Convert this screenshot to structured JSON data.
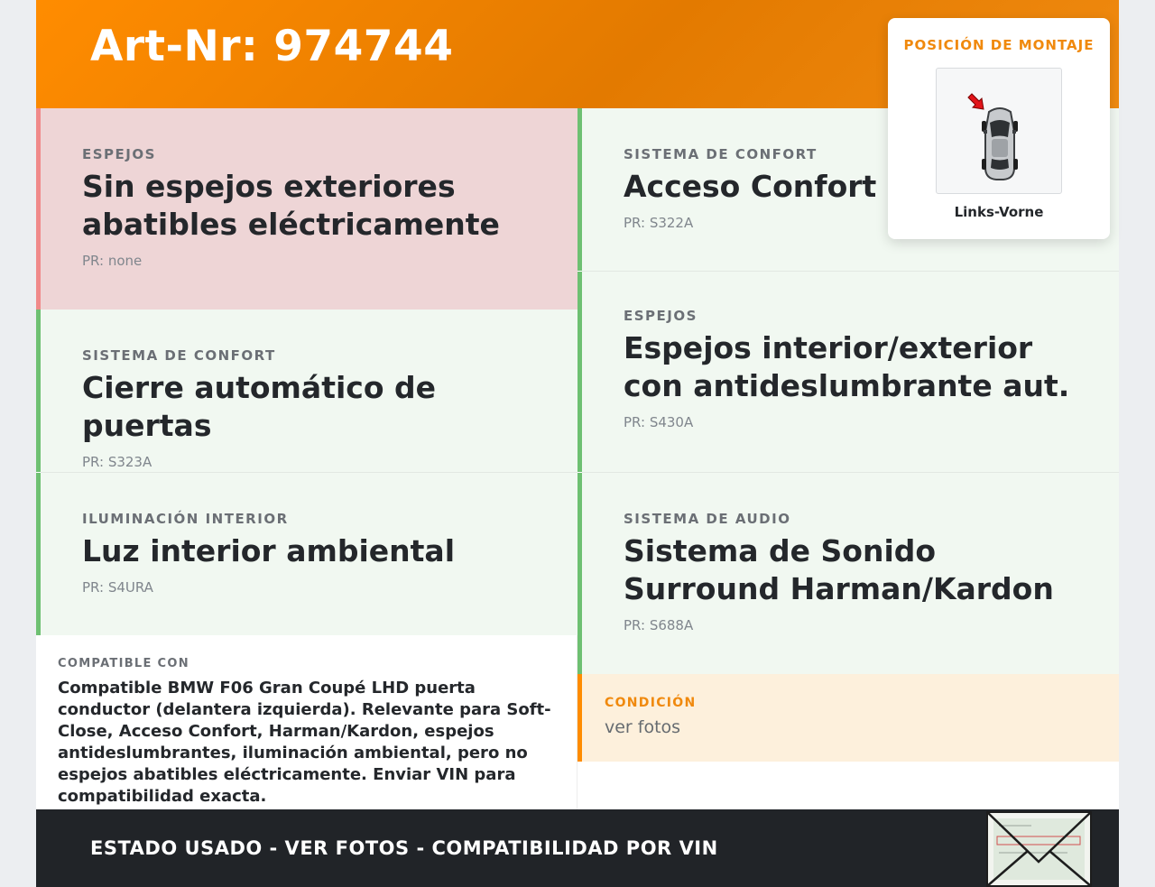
{
  "header": {
    "title": "Art-Nr: 974744"
  },
  "features": [
    {
      "category": "ESPEJOS",
      "value": "Sin espejos exteriores abatibles eléctricamente",
      "pr": "PR: none"
    },
    {
      "category": "SISTEMA DE CONFORT",
      "value": "Acceso Confort",
      "pr": "PR: S322A"
    },
    {
      "category": "SISTEMA DE CONFORT",
      "value": "Cierre automático de puertas",
      "pr": "PR: S323A"
    },
    {
      "category": "ESPEJOS",
      "value": "Espejos interior/exterior con antideslumbrante aut.",
      "pr": "PR: S430A"
    },
    {
      "category": "ILUMINACIÓN INTERIOR",
      "value": "Luz interior ambiental",
      "pr": "PR: S4URA"
    },
    {
      "category": "SISTEMA DE AUDIO",
      "value": "Sistema de Sonido Surround Harman/Kardon",
      "pr": "PR: S688A"
    }
  ],
  "compat": {
    "label": "COMPATIBLE CON",
    "text": "Compatible BMW F06 Gran Coupé LHD puerta conductor (delantera izquierda). Relevante para Soft-Close, Acceso Confort, Harman/Kardon, espejos antideslumbrantes, iluminación ambiental, pero no espejos abatibles eléctricamente. Enviar VIN para compatibilidad exacta."
  },
  "condition": {
    "label": "CONDICIÓN",
    "value": "ver fotos"
  },
  "footer": {
    "text": "ESTADO USADO - VER FOTOS - COMPATIBILIDAD POR VIN"
  },
  "mount": {
    "title": "POSICIÓN DE MONTAJE",
    "label": "Links-Vorne"
  },
  "colors": {
    "accent": "#ff8c00",
    "ok": "#6ec072",
    "bad": "#f08a8a",
    "dark": "#212428"
  },
  "icons": {
    "position": "car-top-view-icon",
    "arrow": "red-arrow-icon",
    "envelope": "envelope-icon"
  }
}
